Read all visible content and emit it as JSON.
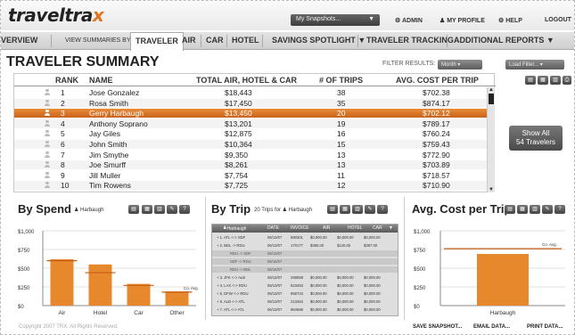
{
  "header": {
    "logo_a": "travel",
    "logo_b": "tra",
    "logo_x": "x",
    "snapshots": "My Snapshots...",
    "links": [
      {
        "label": "⚙ ADMIN"
      },
      {
        "label": "♟ MY PROFILE"
      },
      {
        "label": "⚙ HELP"
      },
      {
        "label": "LOGOUT"
      }
    ]
  },
  "nav": {
    "overview": "VERVIEW",
    "view_by": "VIEW SUMMARIES BY:",
    "tabs": [
      "TRAVELER",
      "AIR",
      "CAR",
      "HOTEL"
    ],
    "menus": [
      "SAVINGS SPOTLIGHT ▼",
      "TRAVELER TRACKING",
      "ADDITIONAL REPORTS ▼"
    ]
  },
  "summary": {
    "title": "TRAVELER SUMMARY",
    "filter_label": "FILTER RESULTS:",
    "filter_month": "Month",
    "filter_load": "Load Filter...",
    "columns": [
      "RANK",
      "NAME",
      "TOTAL AIR, HOTEL & CAR",
      "# OF TRIPS",
      "AVG. COST PER TRIP"
    ],
    "rows": [
      {
        "rank": "1",
        "name": "Jose Gonzalez",
        "total": "$18,443",
        "trips": "38",
        "avg": "$702.38"
      },
      {
        "rank": "2",
        "name": "Rosa Smith",
        "total": "$17,450",
        "trips": "35",
        "avg": "$874.17"
      },
      {
        "rank": "3",
        "name": "Gerry Harbaugh",
        "total": "$13,450",
        "trips": "20",
        "avg": "$702.12"
      },
      {
        "rank": "4",
        "name": "Anthony Soprano",
        "total": "$13,201",
        "trips": "19",
        "avg": "$789.17"
      },
      {
        "rank": "5",
        "name": "Jay Giles",
        "total": "$12,875",
        "trips": "16",
        "avg": "$760.24"
      },
      {
        "rank": "6",
        "name": "John Smith",
        "total": "$10,364",
        "trips": "15",
        "avg": "$759.43"
      },
      {
        "rank": "7",
        "name": "Jim Smythe",
        "total": "$9,350",
        "trips": "13",
        "avg": "$772.90"
      },
      {
        "rank": "8",
        "name": "Joe Smurff",
        "total": "$8,261",
        "trips": "13",
        "avg": "$703.89"
      },
      {
        "rank": "9",
        "name": "Jill Muller",
        "total": "$7,754",
        "trips": "11",
        "avg": "$718.57"
      },
      {
        "rank": "10",
        "name": "Tim Rowens",
        "total": "$7,725",
        "trips": "12",
        "avg": "$710.90"
      }
    ],
    "selected_rank": "3",
    "show_all_1": "Show All",
    "show_all_2": "54 Travelers"
  },
  "by_spend": {
    "title": "By Spend",
    "traveler": "Harbaugh",
    "chart_data": {
      "type": "bar",
      "categories": [
        "Air",
        "Hotel",
        "Car",
        "Other"
      ],
      "values": [
        620,
        550,
        290,
        190
      ],
      "avg_values": [
        600,
        440,
        270,
        180
      ],
      "avg_label": "Co. Avg.",
      "yticks": [
        "$1,000",
        "$750",
        "$500",
        "$250",
        "$0"
      ],
      "ylim": [
        0,
        1000
      ]
    }
  },
  "by_trip": {
    "title": "By Trip",
    "subtitle": "20 Trips for",
    "traveler": "Harbaugh",
    "columns": [
      "Harbaugh",
      "DATE",
      "INVOICE",
      "AIR",
      "HOTEL",
      "CAR"
    ],
    "rows": [
      {
        "trip": "+ 1. ATL <-> SDF",
        "date": "06/13/07",
        "inv": "690301",
        "air": "$0,000.00",
        "hotel": "$0,000.00",
        "car": "$0,000.00",
        "sub": false
      },
      {
        "trip": "+ 2. BDL -> RDU",
        "date": "06/13/07",
        "inv": "170177",
        "air": "$380.00",
        "hotel": "$120.00",
        "car": "$387.00",
        "sub": false
      },
      {
        "trip": "RDU -> SDF",
        "date": "06/13/07",
        "inv": "",
        "air": "",
        "hotel": "",
        "car": "",
        "sub": true
      },
      {
        "trip": "SDF -> RDU",
        "date": "06/16/07",
        "inv": "",
        "air": "",
        "hotel": "",
        "car": "",
        "sub": true
      },
      {
        "trip": "RDU -> BDL",
        "date": "06/16/07",
        "inv": "",
        "air": "",
        "hotel": "",
        "car": "",
        "sub": true
      },
      {
        "trip": "+ 3. JFK <-> ALB",
        "date": "06/13/07",
        "inv": "298589",
        "air": "$0,000.00",
        "hotel": "$0,000.00",
        "car": "$0,000.00",
        "sub": false
      },
      {
        "trip": "+ 4. LAX <-> RDU",
        "date": "06/13/07",
        "inv": "523453",
        "air": "$0,000.00",
        "hotel": "$0,000.00",
        "car": "$0,000.00",
        "sub": false
      },
      {
        "trip": "+ 5. DFW <-> RDU",
        "date": "06/13/07",
        "inv": "958734",
        "air": "$0,000.00",
        "hotel": "$0,000.00",
        "car": "$0,000.00",
        "sub": false
      },
      {
        "trip": "+ 6. ALB <-> ATL",
        "date": "06/13/07",
        "inv": "213454",
        "air": "$0,000.00",
        "hotel": "$0,000.00",
        "car": "$0,000.00",
        "sub": false
      },
      {
        "trip": "+ 7. ATL <-> ATL",
        "date": "06/13/07",
        "inv": "964586",
        "air": "$0,000.00",
        "hotel": "$0,000.00",
        "car": "$0,000.00",
        "sub": false
      }
    ]
  },
  "avg_cost": {
    "title": "Avg. Cost per Trip",
    "chart_data": {
      "type": "bar",
      "categories": [
        "Harbaugh"
      ],
      "values": [
        690
      ],
      "avg_value": 760,
      "avg_label": "Co. Avg.",
      "yticks": [
        "$1,000",
        "$750",
        "$500",
        "$250",
        "$0"
      ],
      "ylim": [
        0,
        1000
      ]
    }
  },
  "footer": {
    "copyright": "Copyright 2007 TRX. All Rights Reserved.",
    "save": "SAVE SNAPSHOT...",
    "email": "EMAIL DATA...",
    "print": "PRINT DATA..."
  },
  "colors": {
    "accent": "#e0761e",
    "bar": "#e8882c",
    "selected": "#d06a20"
  }
}
